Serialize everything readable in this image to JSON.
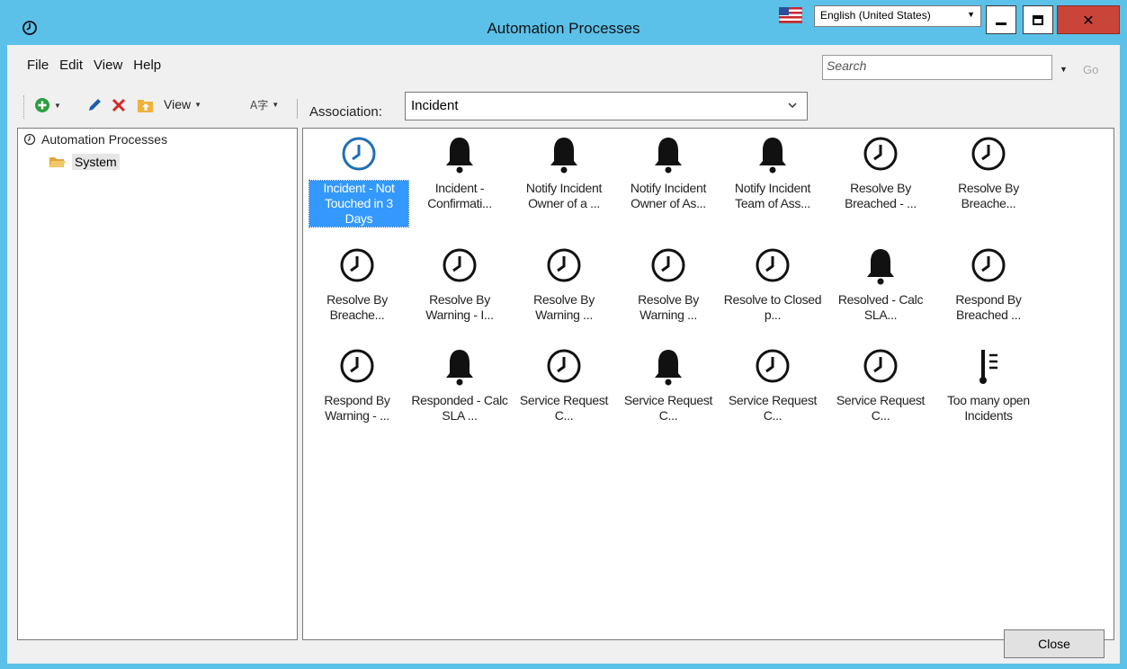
{
  "window": {
    "title": "Automation Processes",
    "language": "English (United States)"
  },
  "menu": {
    "items": [
      "File",
      "Edit",
      "View",
      "Help"
    ]
  },
  "search": {
    "placeholder": "Search",
    "go_label": "Go"
  },
  "toolbar": {
    "view_label": "View",
    "association_label": "Association:",
    "association_value": "Incident"
  },
  "tree": {
    "root": "Automation Processes",
    "child": "System"
  },
  "processes": [
    {
      "label": "Incident -  Not Touched in 3 Days",
      "icon": "clock",
      "selected": true
    },
    {
      "label": "Incident - Confirmati...",
      "icon": "bell"
    },
    {
      "label": "Notify Incident Owner of a ...",
      "icon": "bell"
    },
    {
      "label": "Notify Incident Owner of As...",
      "icon": "bell"
    },
    {
      "label": "Notify Incident Team of Ass...",
      "icon": "bell"
    },
    {
      "label": "Resolve By Breached - ...",
      "icon": "clock"
    },
    {
      "label": "Resolve By Breache...",
      "icon": "clock"
    },
    {
      "label": "Resolve By Breache...",
      "icon": "clock"
    },
    {
      "label": "Resolve By Warning - I...",
      "icon": "clock"
    },
    {
      "label": "Resolve By Warning ...",
      "icon": "clock"
    },
    {
      "label": "Resolve By Warning ...",
      "icon": "clock"
    },
    {
      "label": "Resolve to Closed p...",
      "icon": "clock"
    },
    {
      "label": "Resolved - Calc SLA...",
      "icon": "bell"
    },
    {
      "label": "Respond By Breached ...",
      "icon": "clock"
    },
    {
      "label": "Respond By Warning - ...",
      "icon": "clock"
    },
    {
      "label": "Responded - Calc SLA ...",
      "icon": "bell"
    },
    {
      "label": "Service Request C...",
      "icon": "clock"
    },
    {
      "label": "Service Request C...",
      "icon": "bell"
    },
    {
      "label": "Service Request C...",
      "icon": "clock"
    },
    {
      "label": "Service Request C...",
      "icon": "clock"
    },
    {
      "label": "Too many open Incidents",
      "icon": "threshold"
    }
  ],
  "footer": {
    "close_label": "Close"
  },
  "colors": {
    "titlebar": "#5bc1e9",
    "selection": "#3399ff",
    "close_red": "#c9453a",
    "add_green": "#2e9e3f",
    "delete_red": "#d42a2a",
    "edit_blue": "#1f5fa8"
  }
}
